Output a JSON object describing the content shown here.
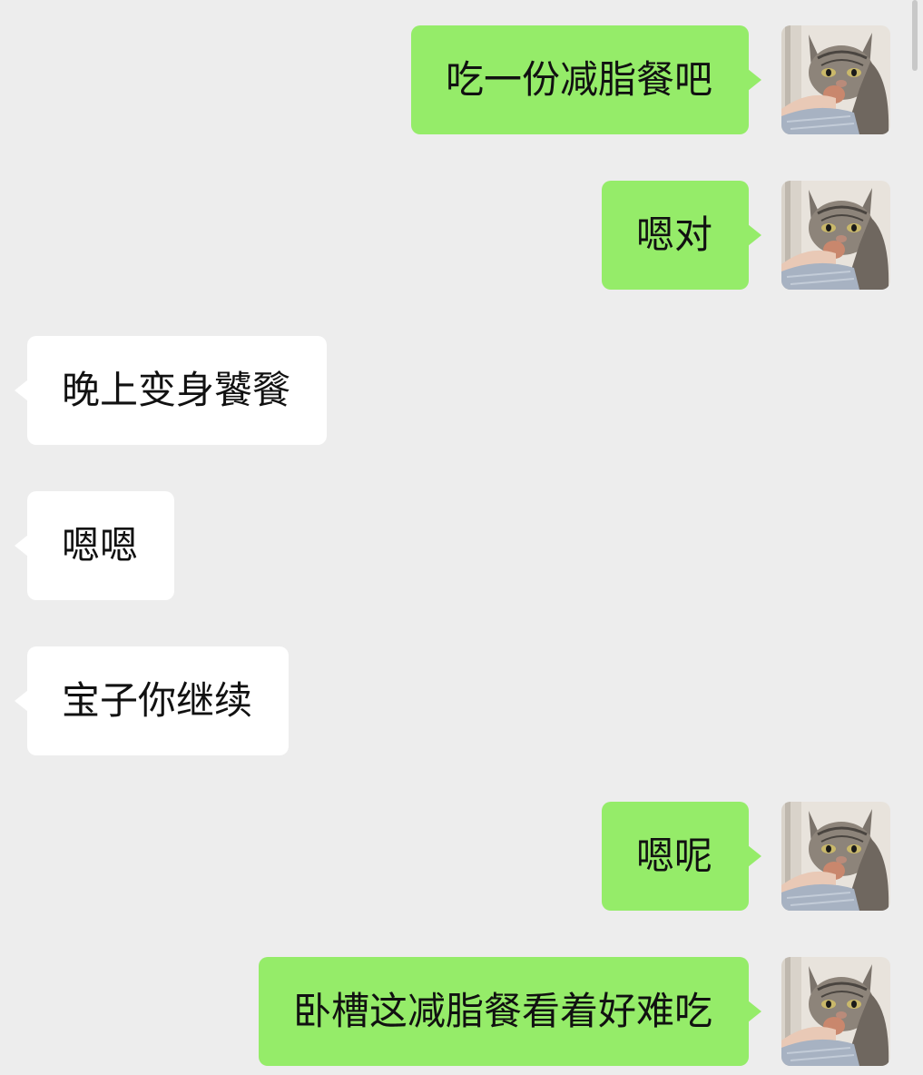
{
  "messages": [
    {
      "direction": "outgoing",
      "text": "吃一份减脂餐吧",
      "avatar": "cat-avatar"
    },
    {
      "direction": "outgoing",
      "text": "嗯对",
      "avatar": "cat-avatar"
    },
    {
      "direction": "incoming",
      "text": "晚上变身饕餮"
    },
    {
      "direction": "incoming",
      "text": "嗯嗯"
    },
    {
      "direction": "incoming",
      "text": "宝子你继续"
    },
    {
      "direction": "outgoing",
      "text": "嗯呢",
      "avatar": "cat-avatar"
    },
    {
      "direction": "outgoing",
      "text": "卧槽这减脂餐看着好难吃",
      "avatar": "cat-avatar"
    }
  ],
  "colors": {
    "background": "#ededed",
    "outgoing_bubble": "#95ec69",
    "incoming_bubble": "#ffffff",
    "text": "#111111"
  }
}
